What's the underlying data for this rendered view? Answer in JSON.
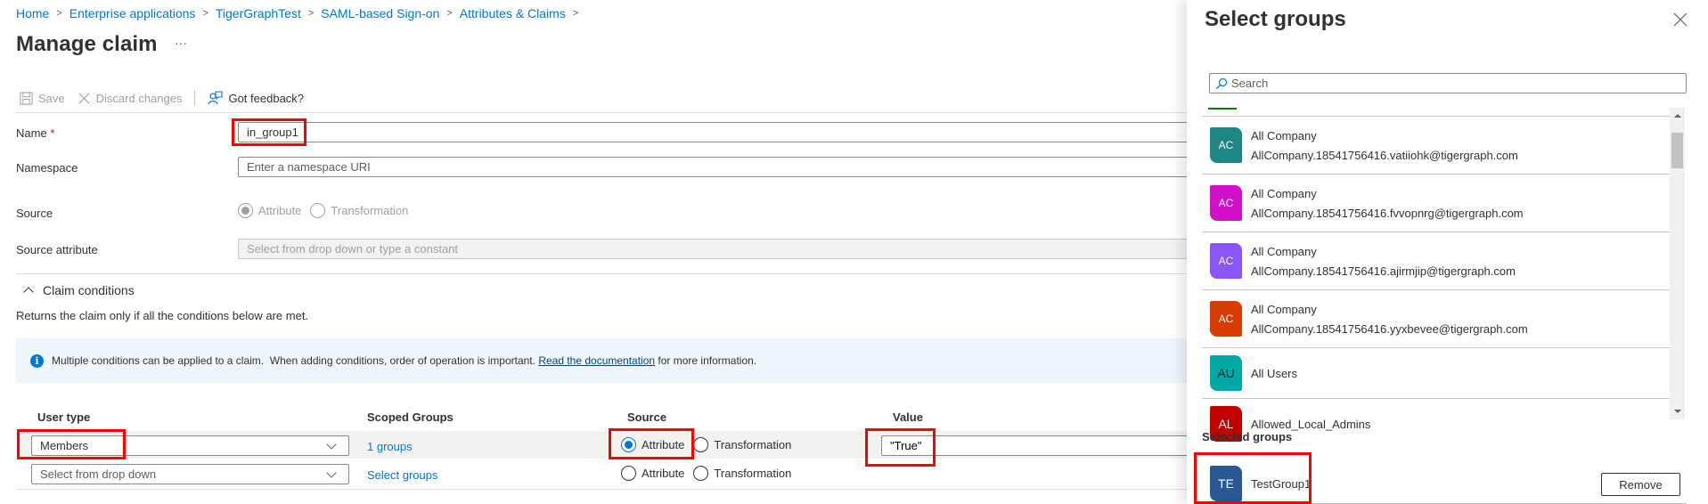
{
  "breadcrumb": [
    "Home",
    "Enterprise applications",
    "TigerGraphTest",
    "SAML-based Sign-on",
    "Attributes & Claims"
  ],
  "header": {
    "title": "Manage claim",
    "more": "···"
  },
  "toolbar": {
    "save_label": "Save",
    "discard_label": "Discard changes",
    "feedback_label": "Got feedback?",
    "icons": {
      "save": "save-icon",
      "discard": "close-icon",
      "feedback": "feedback-icon"
    }
  },
  "form": {
    "name_label": "Name",
    "name_required": "*",
    "name_value": "in_group1",
    "namespace_label": "Namespace",
    "namespace_placeholder": "Enter a namespace URI",
    "source_label": "Source",
    "source_options": [
      {
        "label": "Attribute",
        "checked": true,
        "disabled": true
      },
      {
        "label": "Transformation",
        "checked": false,
        "disabled": true
      }
    ],
    "source_attribute_label": "Source attribute",
    "source_attribute_placeholder": "Select from drop down or type a constant"
  },
  "conditions": {
    "heading": "Claim conditions",
    "description": "Returns the claim only if all the conditions below are met.",
    "info": {
      "text_before": "Multiple conditions can be applied to a claim.  When adding conditions, order of operation is important. ",
      "link": "Read the documentation",
      "text_after": " for more information."
    },
    "columns": [
      "User type",
      "Scoped Groups",
      "Source",
      "Value"
    ],
    "rows": [
      {
        "user_type": "Members",
        "user_type_is_placeholder": false,
        "scoped_groups": "1 groups",
        "source_selected": "Attribute",
        "source_options": [
          "Attribute",
          "Transformation"
        ],
        "value": "\"True\""
      },
      {
        "user_type": "Select from drop down",
        "user_type_is_placeholder": true,
        "scoped_groups": "Select groups",
        "source_selected": null,
        "source_options": [
          "Attribute",
          "Transformation"
        ],
        "value": ""
      }
    ]
  },
  "panel": {
    "title": "Select groups",
    "close_label": "Close",
    "search_placeholder": "Search",
    "groups": [
      {
        "initials": "AC",
        "name": "All Company",
        "email": "AllCompany.18541756416.vatiiohk@tigergraph.com",
        "color": "#1f8484"
      },
      {
        "initials": "AC",
        "name": "All Company",
        "email": "AllCompany.18541756416.fvvopnrg@tigergraph.com",
        "color": "#d20fc9"
      },
      {
        "initials": "AC",
        "name": "All Company",
        "email": "AllCompany.18541756416.ajirmjip@tigergraph.com",
        "color": "#8b55f6"
      },
      {
        "initials": "AC",
        "name": "All Company",
        "email": "AllCompany.18541756416.yyxbevee@tigergraph.com",
        "color": "#da3b01"
      },
      {
        "initials": "AU",
        "name": "All Users",
        "email": "",
        "color": "#00a9a6"
      },
      {
        "initials": "AL",
        "name": "Allowed_Local_Admins",
        "email": "",
        "color": "#c30000"
      }
    ],
    "selected_title": "Selected groups",
    "selected": [
      {
        "initials": "TE",
        "name": "TestGroup1",
        "color": "#2b5797"
      }
    ],
    "remove_label": "Remove"
  },
  "colors": {
    "accent": "#0078d4",
    "highlight": "#ff0000"
  }
}
